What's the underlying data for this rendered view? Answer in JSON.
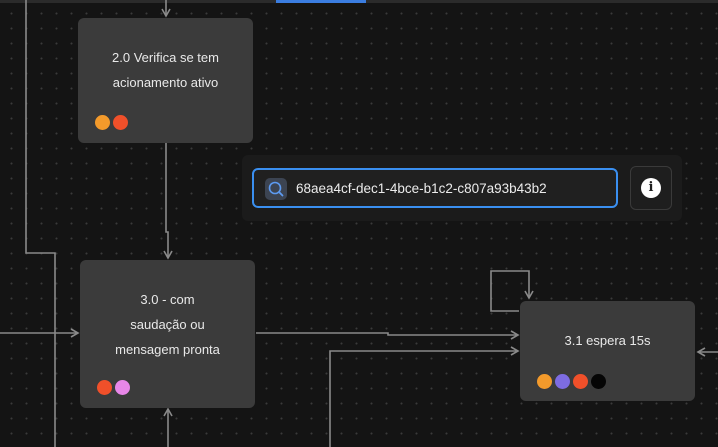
{
  "canvas": {
    "background": "#141414",
    "grid_dot_color": "#3a3a3a",
    "edge_color": "#8a8a8a"
  },
  "nodes": [
    {
      "id": "node-2-0",
      "title_lines": [
        "2.0 Verifica se tem",
        "acionamento ativo"
      ],
      "status_dots": [
        "#f39a2b",
        "#f0502a"
      ]
    },
    {
      "id": "node-3-0",
      "title_lines": [
        "3.0 - com",
        "saudação ou",
        "mensagem pronta"
      ],
      "status_dots": [
        "#f0502a",
        "#e887e8"
      ]
    },
    {
      "id": "node-3-1",
      "title_lines": [
        "3.1 espera 15s"
      ],
      "status_dots": [
        "#f39a2b",
        "#7d6ce2",
        "#f0502a",
        "#050505"
      ]
    }
  ],
  "search": {
    "value": "68aea4cf-dec1-4bce-b1c2-c807a93b43b2",
    "icon": "search-icon",
    "accent_color": "#3a8ff0"
  },
  "info_button": {
    "icon": "info-icon",
    "glyph": "i"
  }
}
